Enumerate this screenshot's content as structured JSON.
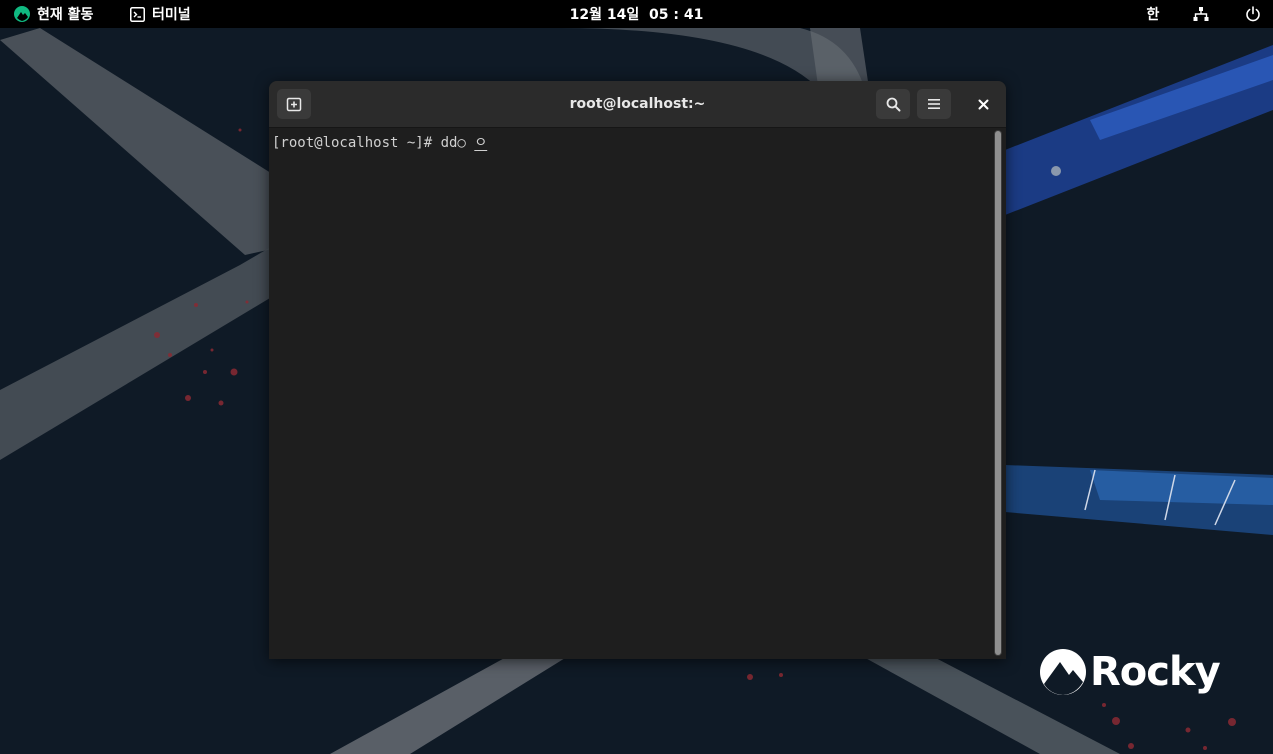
{
  "topbar": {
    "activities_label": "현재 활동",
    "app_label": "터미널",
    "clock": "12월 14일  05 : 41",
    "ime_label": "한",
    "icons": {
      "activities": "rocky-logo-icon",
      "app": "terminal-icon",
      "network": "network-wired-icon",
      "power": "power-icon"
    }
  },
  "terminal": {
    "title": "root@localhost:~",
    "prompt": "[root@localhost ~]# ",
    "typed": "dd○",
    "preedit": "ㅇ",
    "icons": {
      "new_tab": "new-tab-icon",
      "search": "search-icon",
      "menu": "hamburger-menu-icon",
      "close": "close-icon"
    }
  },
  "wallpaper": {
    "logo_text": "Rocky"
  },
  "colors": {
    "topbar_bg": "#000000",
    "desktop_bg": "#0f1a26",
    "terminal_bg": "#1e1e1e",
    "header_bg": "#2b2b2b",
    "rocky_green": "#10b981"
  }
}
